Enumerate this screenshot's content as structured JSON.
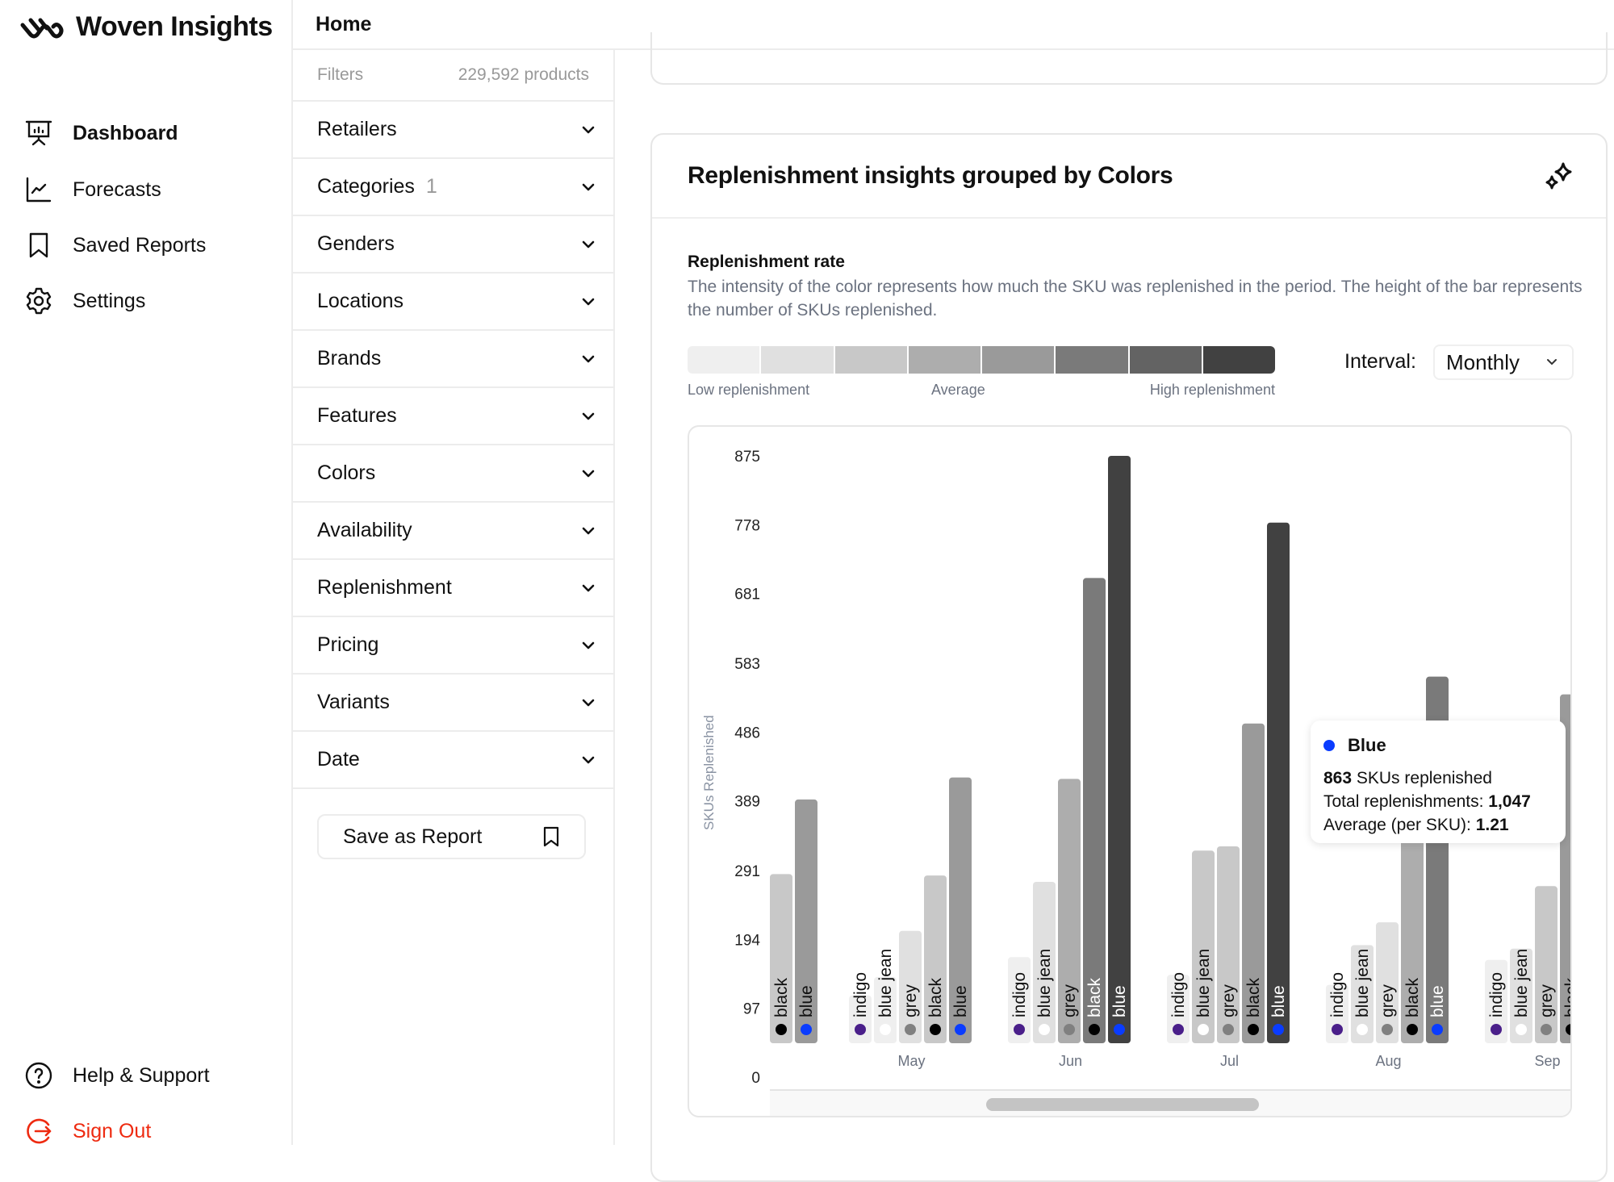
{
  "app": {
    "name": "Woven Insights"
  },
  "sidebar": {
    "items": [
      {
        "label": "Dashboard",
        "icon": "presentation-chart-icon",
        "active": true
      },
      {
        "label": "Forecasts",
        "icon": "line-chart-icon",
        "active": false
      },
      {
        "label": "Saved Reports",
        "icon": "bookmark-icon",
        "active": false
      },
      {
        "label": "Settings",
        "icon": "gear-icon",
        "active": false
      }
    ],
    "bottom": [
      {
        "label": "Help & Support",
        "icon": "help-circle-icon"
      },
      {
        "label": "Sign Out",
        "icon": "sign-out-icon"
      }
    ]
  },
  "header": {
    "title": "Home"
  },
  "filters": {
    "title": "Filters",
    "product_count": "229,592 products",
    "items": [
      {
        "label": "Retailers",
        "count": ""
      },
      {
        "label": "Categories",
        "count": "1"
      },
      {
        "label": "Genders",
        "count": ""
      },
      {
        "label": "Locations",
        "count": ""
      },
      {
        "label": "Brands",
        "count": ""
      },
      {
        "label": "Features",
        "count": ""
      },
      {
        "label": "Colors",
        "count": ""
      },
      {
        "label": "Availability",
        "count": ""
      },
      {
        "label": "Replenishment",
        "count": ""
      },
      {
        "label": "Pricing",
        "count": ""
      },
      {
        "label": "Variants",
        "count": ""
      },
      {
        "label": "Date",
        "count": ""
      }
    ],
    "save_label": "Save as Report"
  },
  "card": {
    "title": "Replenishment insights grouped by Colors",
    "rate_title": "Replenishment rate",
    "rate_description": "The intensity of the color represents how much the SKU was replenished in the period. The height of the bar represents the number of SKUs replenished.",
    "legend_scale": [
      "#efefef",
      "#e0e0e0",
      "#c8c8c8",
      "#adadad",
      "#9a9a9a",
      "#7a7a7a",
      "#636363",
      "#414141"
    ],
    "legend_labels": {
      "low": "Low replenishment",
      "avg": "Average",
      "high": "High replenishment"
    },
    "interval_label": "Interval:",
    "interval_value": "Monthly"
  },
  "tooltip": {
    "series": "Blue",
    "dot_color": "#0a3cff",
    "skus": "863",
    "skus_suffix": " SKUs replenished",
    "total_label": "Total replenishments: ",
    "total": "1,047",
    "avg_label": "Average (per SKU): ",
    "avg": "1.21"
  },
  "chart_data": {
    "type": "bar",
    "ylabel": "SKUs Replenished",
    "yticks": [
      0,
      97,
      194,
      291,
      389,
      486,
      583,
      681,
      778,
      875
    ],
    "ylim": [
      0,
      875
    ],
    "dot_colors": {
      "black": "#000000",
      "blue": "#0a3cff",
      "indigo": "#4a1f8a",
      "blue jean": "#ffffff",
      "grey": "#808080"
    },
    "groups": [
      {
        "label": "",
        "bars": [
          {
            "name": "black",
            "value": 286,
            "shade": "#c8c8c8"
          },
          {
            "name": "blue",
            "value": 391,
            "shade": "#9a9a9a"
          }
        ]
      },
      {
        "label": "May",
        "bars": [
          {
            "name": "indigo",
            "value": 115,
            "shade": "#efefef"
          },
          {
            "name": "blue jean",
            "value": 141,
            "shade": "#efefef"
          },
          {
            "name": "grey",
            "value": 206,
            "shade": "#e0e0e0"
          },
          {
            "name": "black",
            "value": 284,
            "shade": "#c8c8c8"
          },
          {
            "name": "blue",
            "value": 422,
            "shade": "#9a9a9a"
          }
        ]
      },
      {
        "label": "Jun",
        "bars": [
          {
            "name": "indigo",
            "value": 169,
            "shade": "#efefef"
          },
          {
            "name": "blue jean",
            "value": 275,
            "shade": "#e0e0e0"
          },
          {
            "name": "grey",
            "value": 420,
            "shade": "#adadad"
          },
          {
            "name": "black",
            "value": 703,
            "shade": "#7a7a7a"
          },
          {
            "name": "blue",
            "value": 875,
            "shade": "#414141"
          }
        ]
      },
      {
        "label": "Jul",
        "bars": [
          {
            "name": "indigo",
            "value": 144,
            "shade": "#efefef"
          },
          {
            "name": "blue jean",
            "value": 319,
            "shade": "#c8c8c8"
          },
          {
            "name": "grey",
            "value": 325,
            "shade": "#c8c8c8"
          },
          {
            "name": "black",
            "value": 498,
            "shade": "#9a9a9a"
          },
          {
            "name": "blue",
            "value": 781,
            "shade": "#414141"
          }
        ]
      },
      {
        "label": "Aug",
        "bars": [
          {
            "name": "indigo",
            "value": 130,
            "shade": "#efefef"
          },
          {
            "name": "blue jean",
            "value": 186,
            "shade": "#e0e0e0"
          },
          {
            "name": "grey",
            "value": 218,
            "shade": "#e0e0e0"
          },
          {
            "name": "black",
            "value": 440,
            "shade": "#adadad"
          },
          {
            "name": "blue",
            "value": 564,
            "shade": "#7a7a7a"
          }
        ]
      },
      {
        "label": "Sep",
        "bars": [
          {
            "name": "indigo",
            "value": 165,
            "shade": "#efefef"
          },
          {
            "name": "blue jean",
            "value": 181,
            "shade": "#e0e0e0"
          },
          {
            "name": "grey",
            "value": 269,
            "shade": "#c8c8c8"
          },
          {
            "name": "black",
            "value": 539,
            "shade": "#9a9a9a"
          }
        ]
      }
    ]
  }
}
